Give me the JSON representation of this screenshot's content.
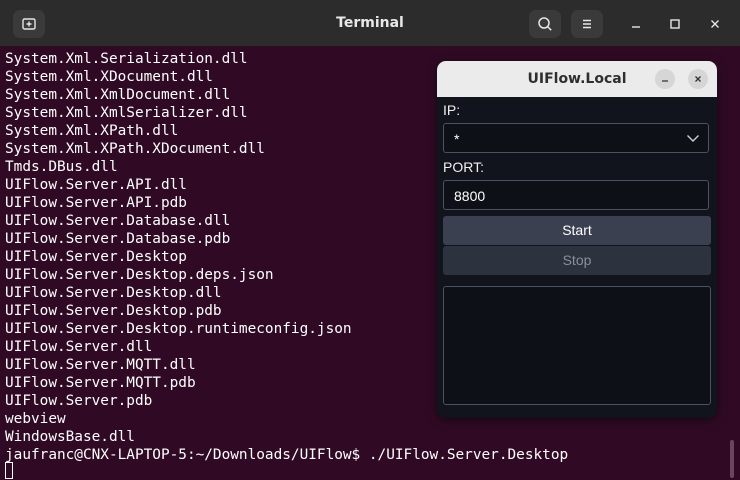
{
  "window": {
    "title": "Terminal",
    "new_tab_icon": "new-tab-icon",
    "search_icon": "search-icon",
    "menu_icon": "hamburger-menu-icon",
    "minimize_icon": "minimize-icon",
    "maximize_icon": "maximize-icon",
    "close_icon": "close-icon"
  },
  "terminal": {
    "lines": [
      "System.Xml.Serialization.dll",
      "System.Xml.XDocument.dll",
      "System.Xml.XmlDocument.dll",
      "System.Xml.XmlSerializer.dll",
      "System.Xml.XPath.dll",
      "System.Xml.XPath.XDocument.dll",
      "Tmds.DBus.dll",
      "UIFlow.Server.API.dll",
      "UIFlow.Server.API.pdb",
      "UIFlow.Server.Database.dll",
      "UIFlow.Server.Database.pdb",
      "UIFlow.Server.Desktop",
      "UIFlow.Server.Desktop.deps.json",
      "UIFlow.Server.Desktop.dll",
      "UIFlow.Server.Desktop.pdb",
      "UIFlow.Server.Desktop.runtimeconfig.json",
      "UIFlow.Server.dll",
      "UIFlow.Server.MQTT.dll",
      "UIFlow.Server.MQTT.pdb",
      "UIFlow.Server.pdb",
      "webview",
      "WindowsBase.dll",
      "jaufranc@CNX-LAPTOP-5:~/Downloads/UIFlow$ ./UIFlow.Server.Desktop"
    ]
  },
  "app": {
    "title": "UIFlow.Local",
    "ip_label": "IP:",
    "ip_value": "*",
    "port_label": "PORT:",
    "port_value": "8800",
    "start_label": "Start",
    "stop_label": "Stop",
    "log_text": ""
  },
  "colors": {
    "terminal_bg": "#300a24",
    "titlebar_bg": "#2c2c2c",
    "app_bg": "#11141c"
  }
}
